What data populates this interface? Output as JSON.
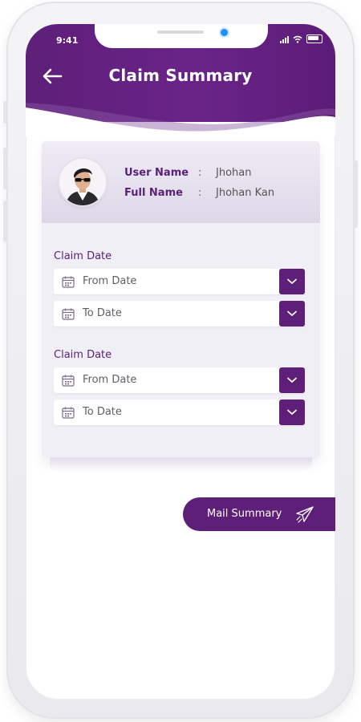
{
  "status_bar": {
    "time": "9:41"
  },
  "header": {
    "title": "Claim Summary"
  },
  "profile": {
    "user_name_label": "User Name",
    "user_name_value": "Jhohan",
    "full_name_label": "Full Name",
    "full_name_value": "Jhohan Kan",
    "separator": ":"
  },
  "claim_sections": [
    {
      "label": "Claim Date",
      "from_placeholder": "From Date",
      "to_placeholder": "To Date"
    },
    {
      "label": "Claim Date",
      "from_placeholder": "From Date",
      "to_placeholder": "To Date"
    }
  ],
  "mail_button": {
    "label": "Mail Summary"
  },
  "colors": {
    "primary": "#5d1f78",
    "card_bg": "#f1eff6",
    "label": "#5a2277"
  },
  "icons": [
    "back-arrow-icon",
    "calendar-icon",
    "chevron-down-icon",
    "paper-plane-icon",
    "signal-icon",
    "wifi-icon",
    "battery-icon"
  ]
}
